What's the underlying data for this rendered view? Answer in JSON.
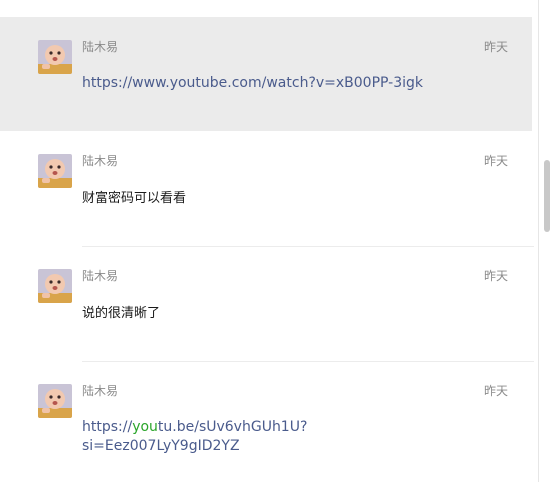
{
  "messages": [
    {
      "sender": "陆木易",
      "time": "昨天",
      "text": "https://www.youtube.com/watch?v=xB00PP-3igk"
    },
    {
      "sender": "陆木易",
      "time": "昨天",
      "text": "财富密码可以看看"
    },
    {
      "sender": "陆木易",
      "time": "昨天",
      "text": "说的很清晰了"
    },
    {
      "sender": "陆木易",
      "time": "昨天",
      "link_pre": "https://",
      "link_highlight": "you",
      "link_post": "tu.be/sUv6vhGUh1U?",
      "link_line2": "si=Eez007LyY9gID2YZ"
    }
  ],
  "colors": {
    "highlight_row": "#ebebeb",
    "link": "#4a5b8c",
    "link_highlight": "#2aa52a"
  }
}
